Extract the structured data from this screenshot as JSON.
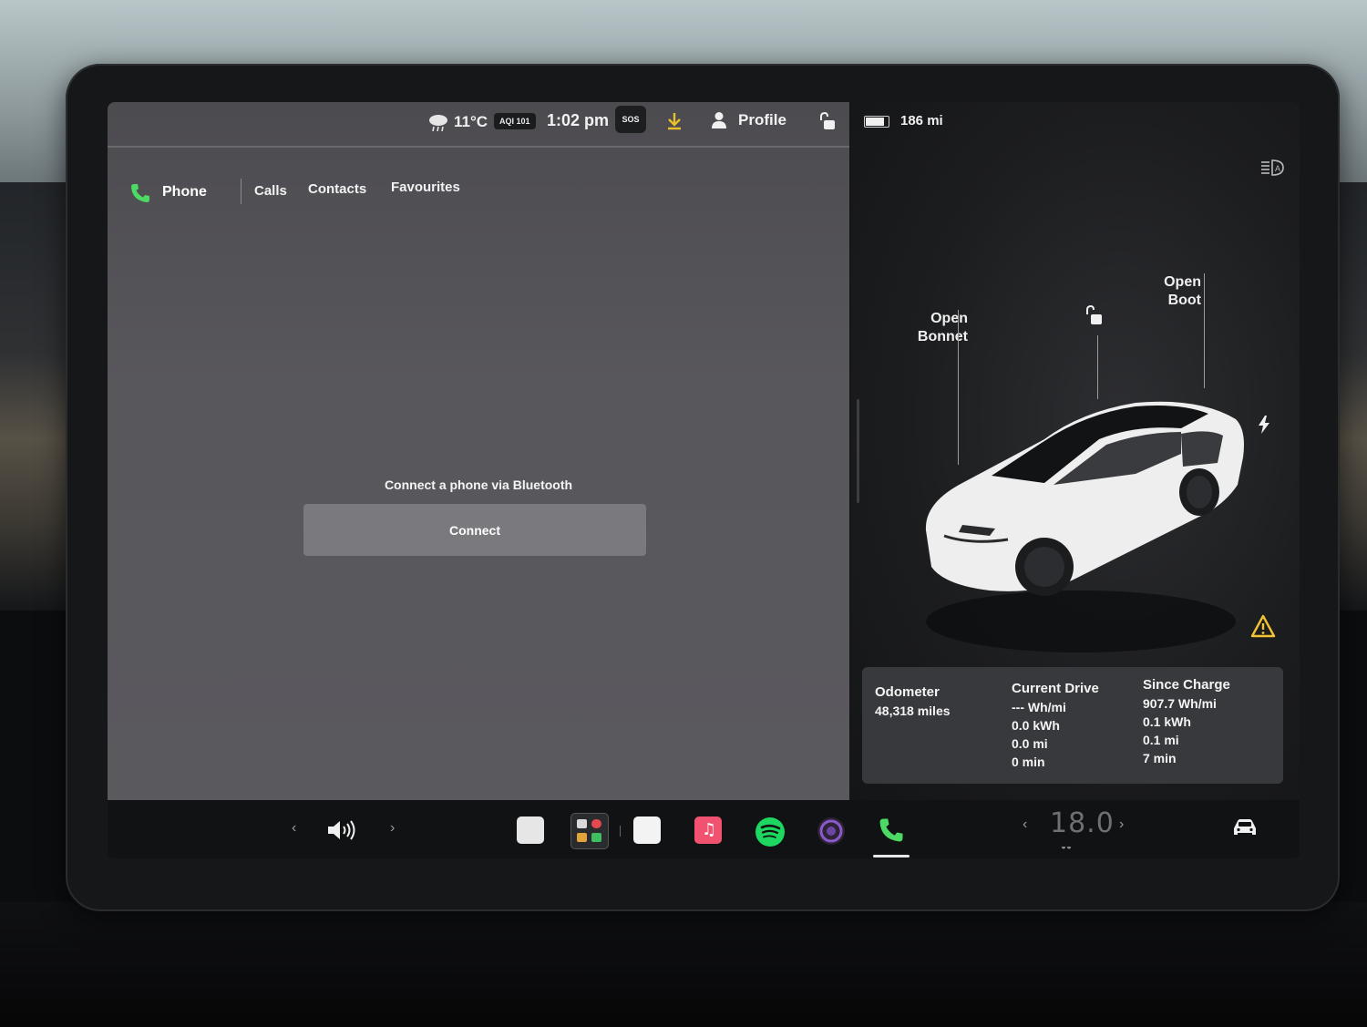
{
  "status_bar": {
    "temperature": "11°C",
    "aqi": "AQI 101",
    "time": "1:02 pm",
    "sos_label": "SOS",
    "profile_label": "Profile",
    "range": "186 mi",
    "battery_level": 0.85
  },
  "phone_app": {
    "title": "Phone",
    "tabs": [
      "Calls",
      "Contacts",
      "Favourites"
    ],
    "message": "Connect a phone via Bluetooth",
    "connect_button": "Connect"
  },
  "car_panel": {
    "open_bonnet": [
      "Open",
      "Bonnet"
    ],
    "open_boot": [
      "Open",
      "Boot"
    ]
  },
  "trip": {
    "odometer": {
      "label": "Odometer",
      "value": "48,318 miles"
    },
    "current_drive": {
      "label": "Current Drive",
      "values": [
        "--- Wh/mi",
        "0.0 kWh",
        "0.0 mi",
        "0 min"
      ]
    },
    "since_charge": {
      "label": "Since Charge",
      "values": [
        "907.7 Wh/mi",
        "0.1 kWh",
        "0.1 mi",
        "7 min"
      ]
    }
  },
  "dock": {
    "climate_temp": "18.0",
    "icons": [
      "volume-icon",
      "notes-app-icon",
      "toybox-app-icon",
      "calendar-app-icon",
      "music-app-icon",
      "spotify-app-icon",
      "camera-app-icon",
      "phone-app-icon",
      "car-icon"
    ]
  },
  "colors": {
    "accent_green": "#4cd964",
    "download_yellow": "#e9c12b",
    "warning_yellow": "#f3c431",
    "music_pink": "#f0526f",
    "spotify_green": "#1ed760"
  }
}
